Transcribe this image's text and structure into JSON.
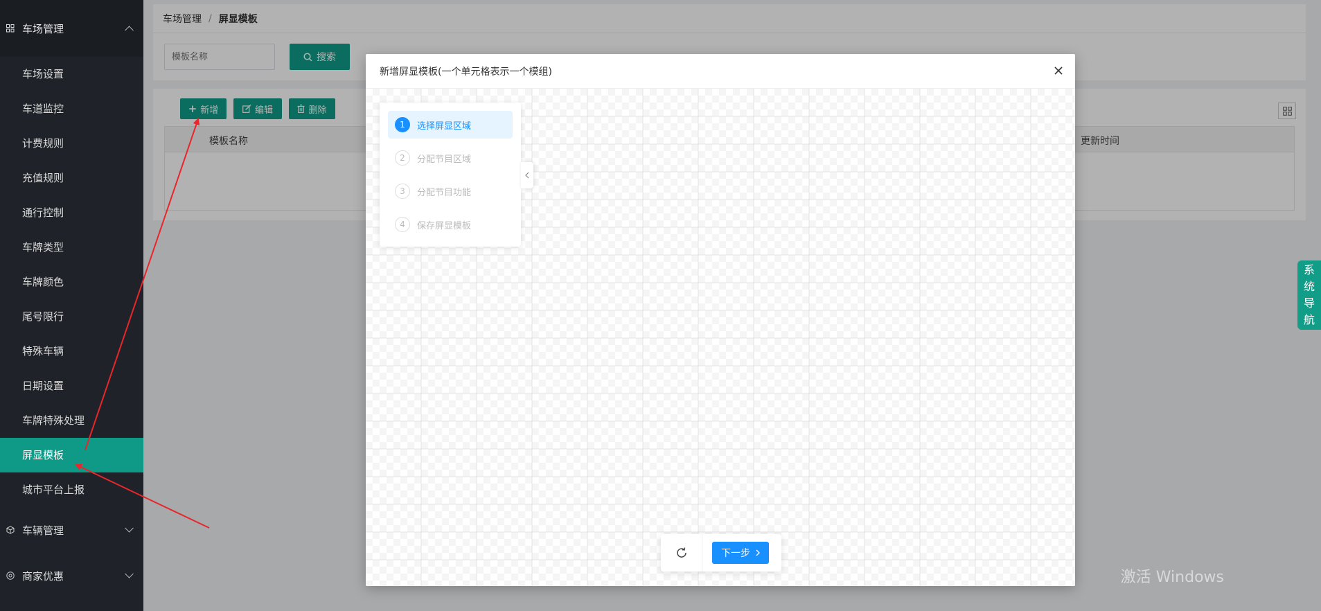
{
  "sidebar": {
    "group1": {
      "label": "车场管理",
      "icon": "parking-grid-icon"
    },
    "items": [
      {
        "label": "车场设置"
      },
      {
        "label": "车道监控"
      },
      {
        "label": "计费规则"
      },
      {
        "label": "充值规则"
      },
      {
        "label": "通行控制"
      },
      {
        "label": "车牌类型"
      },
      {
        "label": "车牌颜色"
      },
      {
        "label": "尾号限行"
      },
      {
        "label": "特殊车辆"
      },
      {
        "label": "日期设置"
      },
      {
        "label": "车牌特殊处理"
      },
      {
        "label": "屏显模板",
        "active": true
      },
      {
        "label": "城市平台上报"
      }
    ],
    "group2": {
      "label": "车辆管理",
      "icon": "cube-icon"
    },
    "group3": {
      "label": "商家优惠",
      "icon": "discount-icon"
    }
  },
  "breadcrumb": {
    "parent": "车场管理",
    "separator": "/",
    "current": "屏显模板"
  },
  "search": {
    "placeholder": "模板名称",
    "button_label": "搜索"
  },
  "toolbar": {
    "add_label": "新增",
    "edit_label": "编辑",
    "delete_label": "删除"
  },
  "table": {
    "columns": [
      "模板名称",
      "更新时间"
    ]
  },
  "side_nav": {
    "label": [
      "系",
      "统",
      "导",
      "航"
    ]
  },
  "watermark": "激活 Windows",
  "modal": {
    "title": "新增屏显模板(一个单元格表示一个模组)",
    "steps": [
      {
        "num": "1",
        "label": "选择屏显区域",
        "active": true
      },
      {
        "num": "2",
        "label": "分配节目区域",
        "active": false
      },
      {
        "num": "3",
        "label": "分配节目功能",
        "active": false
      },
      {
        "num": "4",
        "label": "保存屏显模板",
        "active": false
      }
    ],
    "next_label": "下一步"
  },
  "colors": {
    "primary": "#119d88",
    "active_blue": "#1890ff",
    "sidebar_bg": "#1f2329",
    "annotation_red": "#e8262b"
  }
}
